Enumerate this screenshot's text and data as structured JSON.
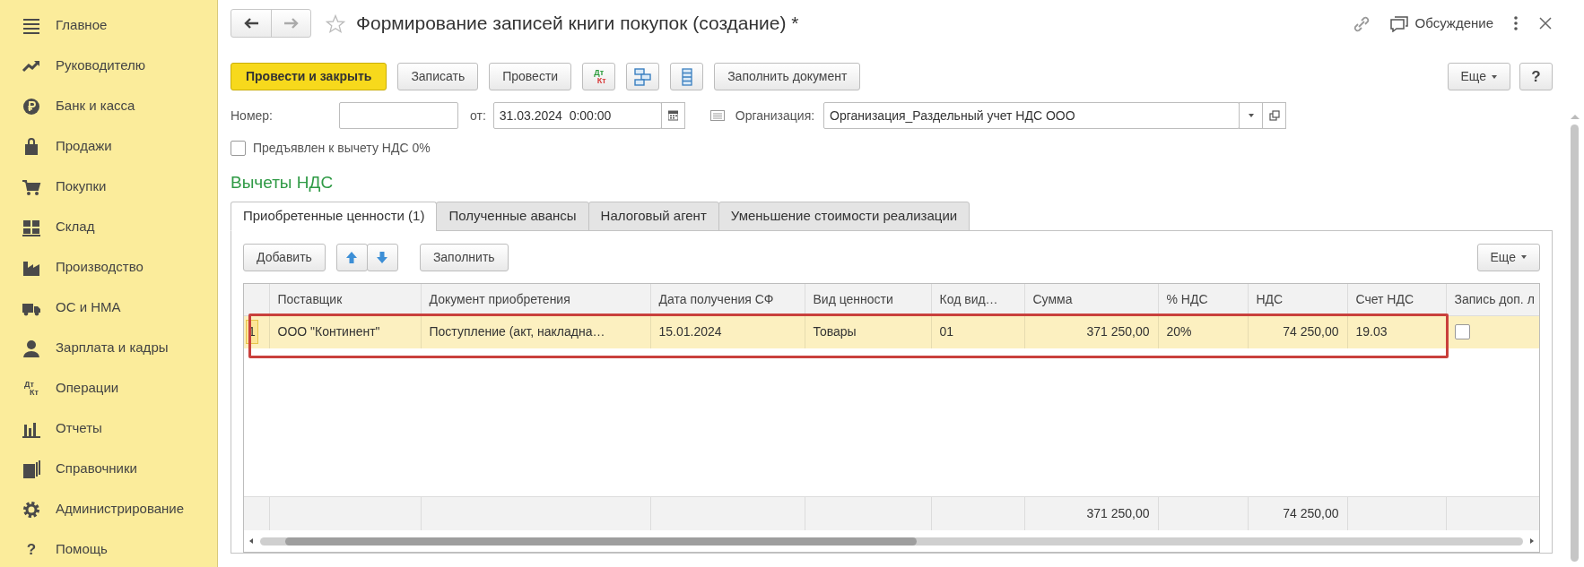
{
  "sidebar": {
    "items": [
      {
        "label": "Главное"
      },
      {
        "label": "Руководителю"
      },
      {
        "label": "Банк и касса"
      },
      {
        "label": "Продажи"
      },
      {
        "label": "Покупки"
      },
      {
        "label": "Склад"
      },
      {
        "label": "Производство"
      },
      {
        "label": "ОС и НМА"
      },
      {
        "label": "Зарплата и кадры"
      },
      {
        "label": "Операции",
        "icon_text": [
          "Дт",
          "Кт"
        ]
      },
      {
        "label": "Отчеты"
      },
      {
        "label": "Справочники"
      },
      {
        "label": "Администрирование"
      },
      {
        "label": "Помощь",
        "icon_text": [
          "?"
        ]
      }
    ]
  },
  "window": {
    "title": "Формирование записей книги покупок (создание) *",
    "discussion": "Обсуждение"
  },
  "toolbar": {
    "buttons": [
      {
        "kind": "primary",
        "label": "Провести и закрыть"
      },
      {
        "kind": "text",
        "label": "Записать"
      },
      {
        "kind": "text",
        "label": "Провести"
      },
      {
        "kind": "dtkt",
        "texts": [
          "Дт",
          "Кт"
        ]
      },
      {
        "kind": "structure"
      },
      {
        "kind": "list"
      },
      {
        "kind": "text",
        "label": "Заполнить документ"
      }
    ],
    "more": "Еще",
    "help": "?"
  },
  "fields": {
    "number": {
      "label": "Номер:"
    },
    "date": {
      "label": "от:",
      "value": "31.03.2024  0:00:00"
    },
    "organization": {
      "label": "Организация:",
      "value": "Организация_Раздельный учет НДС ООО"
    }
  },
  "vat0_checkbox": {
    "label": "Предъявлен к вычету НДС 0%",
    "checked": false
  },
  "section_title": "Вычеты НДС",
  "tabs": [
    {
      "label": "Приобретенные ценности (1)",
      "selected": true
    },
    {
      "label": "Полученные авансы",
      "selected": false
    },
    {
      "label": "Налоговый агент",
      "selected": false
    },
    {
      "label": "Уменьшение стоимости реализации",
      "selected": false
    }
  ],
  "table_toolbar": {
    "add": "Добавить",
    "fill": "Заполнить",
    "more": "Еще"
  },
  "table": {
    "columns": [
      {
        "title": "Поставщик",
        "kind": "text"
      },
      {
        "title": "Документ приобретения",
        "kind": "text"
      },
      {
        "title": "Дата получения СФ",
        "kind": "text"
      },
      {
        "title": "Вид ценности",
        "kind": "text"
      },
      {
        "title": "Код вид…",
        "kind": "text"
      },
      {
        "title": "Сумма",
        "kind": "number",
        "total": "371 250,00"
      },
      {
        "title": "% НДС",
        "kind": "text"
      },
      {
        "title": "НДС",
        "kind": "number",
        "total": "74 250,00"
      },
      {
        "title": "Счет НДС",
        "kind": "text"
      },
      {
        "title": "Запись доп. л",
        "kind": "checkbox"
      }
    ],
    "rows": [
      {
        "number": "1",
        "selected": true,
        "framed": true,
        "cells": [
          "ООО \"Континент\"",
          "Поступление (акт, накладна…",
          "15.01.2024",
          "Товары",
          "01",
          "371 250,00",
          "20%",
          "74 250,00",
          "19.03",
          false
        ]
      }
    ]
  }
}
